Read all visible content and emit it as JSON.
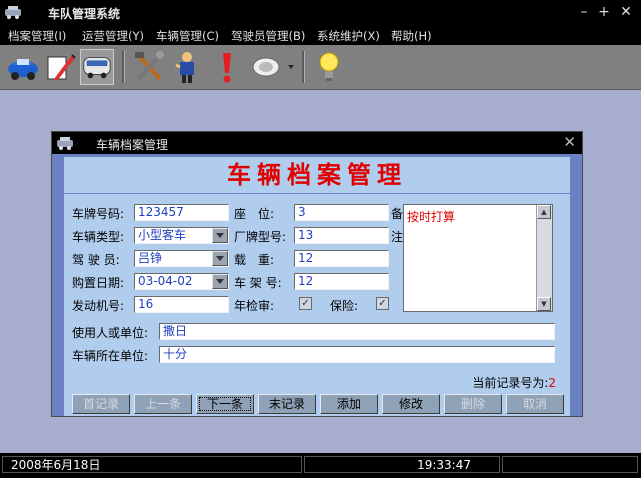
{
  "app": {
    "title": "车队管理系统"
  },
  "menu": [
    {
      "label": "档案管理(I)"
    },
    {
      "label": "运营管理(Y)"
    },
    {
      "label": "车辆管理(C)"
    },
    {
      "label": "驾驶员管理(B)"
    },
    {
      "label": "系统维护(X)"
    },
    {
      "label": "帮助(H)"
    }
  ],
  "toolbar_icons": [
    "car-icon",
    "pen-icon",
    "bus-icon",
    "tools-icon",
    "driver-icon",
    "alert-icon",
    "magnifier-icon",
    "lightbulb-icon"
  ],
  "dialog": {
    "title": "车辆档案管理",
    "header": "车辆档案管理",
    "fields": {
      "plate_label": "车牌号码:",
      "plate": "123457",
      "seats_label": "座　位:",
      "seats": "3",
      "type_label": "车辆类型:",
      "type": "小型客车",
      "model_label": "厂牌型号:",
      "model": "13",
      "driver_label": "驾 驶 员:",
      "driver": "吕铮",
      "load_label": "载　重:",
      "load": "12",
      "purchase_label": "购置日期:",
      "purchase": "03-04-02",
      "frame_label": "车 架 号:",
      "frame": "12",
      "engine_label": "发动机号:",
      "engine": "16",
      "inspection_label": "年检审:",
      "inspection_checked": true,
      "insurance_label": "保险:",
      "insurance_checked": true,
      "memo_label_1": "备",
      "memo_label_2": "注",
      "memo": "按时打算",
      "user_label": "使用人或单位:",
      "user": "撒日",
      "location_label": "车辆所在单位:",
      "location": "十分"
    },
    "record_label": "当前记录号为:",
    "record_number": "2",
    "buttons": [
      {
        "label": "首记录",
        "disabled": true
      },
      {
        "label": "上一条",
        "disabled": true
      },
      {
        "label": "下一条",
        "disabled": false
      },
      {
        "label": "末记录",
        "disabled": false
      },
      {
        "label": "添加",
        "disabled": false
      },
      {
        "label": "修改",
        "disabled": false
      },
      {
        "label": "删除",
        "disabled": true
      },
      {
        "label": "取消",
        "disabled": true
      }
    ]
  },
  "status": {
    "date": "2008年6月18日",
    "time": "19:33:47"
  },
  "colors": {
    "header_text": "#e00000",
    "panel": "#b1cded",
    "dialog_body": "#6c81c4",
    "client": "#a6adcf"
  }
}
